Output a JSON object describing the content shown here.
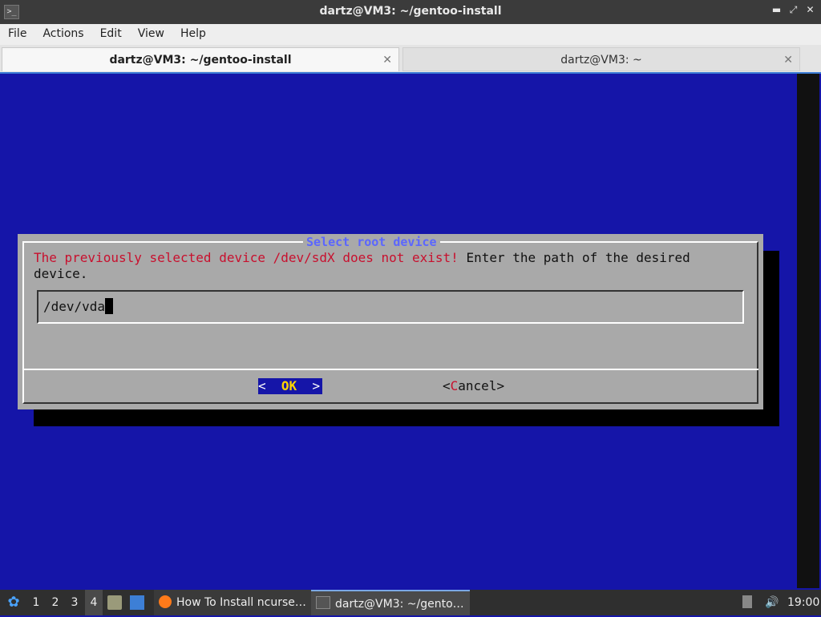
{
  "window": {
    "title": "dartz@VM3: ~/gentoo-install",
    "app_icon_glyph": ">_",
    "controls": {
      "minimize": "▬",
      "maximize": "⤢",
      "close": "✕"
    }
  },
  "menu": [
    "File",
    "Actions",
    "Edit",
    "View",
    "Help"
  ],
  "tabs": [
    {
      "label": "dartz@VM3: ~/gentoo-install",
      "active": true,
      "close": "✕"
    },
    {
      "label": "dartz@VM3: ~",
      "active": false,
      "close": "✕"
    }
  ],
  "dialog": {
    "title": "Select root device",
    "message_error": "The previously selected device /dev/sdX does not exist!",
    "message_rest": " Enter the path of the desired device.",
    "input_value": "/dev/vda",
    "ok_label": "OK",
    "cancel_label": "Cancel"
  },
  "taskbar": {
    "workspaces": [
      "1",
      "2",
      "3",
      "4"
    ],
    "active_workspace": "4",
    "tasks": [
      {
        "label": "How To Install ncurse…",
        "icon": "firefox-icon"
      },
      {
        "label": "dartz@VM3: ~/gento…",
        "icon": "terminal-icon"
      }
    ],
    "clock": "19:00"
  },
  "colors": {
    "terminal_bg": "#1515a8",
    "dialog_bg": "#a9a9a9",
    "error_text": "#c8102e",
    "dialog_title": "#5b66ff"
  }
}
